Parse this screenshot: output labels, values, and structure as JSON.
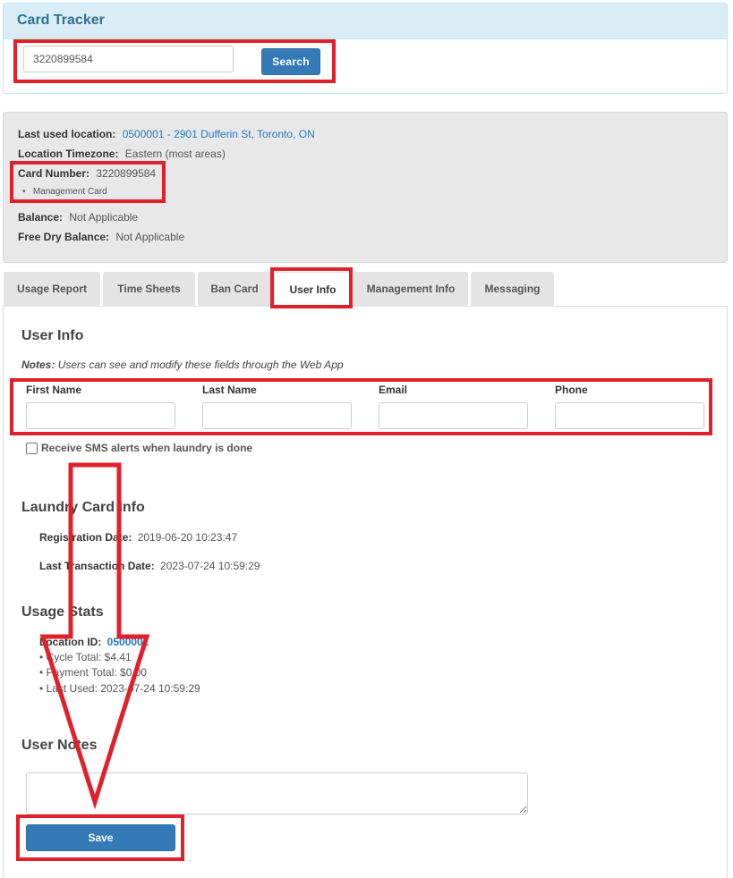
{
  "header": {
    "title": "Card Tracker"
  },
  "search": {
    "value": "3220899584",
    "button_label": "Search"
  },
  "card_info": {
    "last_used_location_label": "Last used location:",
    "last_used_location_value": "0500001 - 2901 Dufferin St, Toronto, ON",
    "timezone_label": "Location Timezone:",
    "timezone_value": "Eastern (most areas)",
    "card_number_label": "Card Number:",
    "card_number_value": "3220899584",
    "card_type": "Management Card",
    "balance_label": "Balance:",
    "balance_value": "Not Applicable",
    "free_dry_label": "Free Dry Balance:",
    "free_dry_value": "Not Applicable"
  },
  "tabs": [
    {
      "label": "Usage Report"
    },
    {
      "label": "Time Sheets"
    },
    {
      "label": "Ban Card"
    },
    {
      "label": "User Info"
    },
    {
      "label": "Management Info"
    },
    {
      "label": "Messaging"
    }
  ],
  "active_tab": "User Info",
  "user_info": {
    "heading": "User Info",
    "notes_label": "Notes:",
    "notes_text": "Users can see and modify these fields through the Web App",
    "fields": [
      {
        "label": "First Name",
        "value": ""
      },
      {
        "label": "Last Name",
        "value": ""
      },
      {
        "label": "Email",
        "value": ""
      },
      {
        "label": "Phone",
        "value": ""
      }
    ],
    "sms_label": "Receive SMS alerts when laundry is done",
    "sms_checked": false
  },
  "laundry_card": {
    "heading": "Laundry Card Info",
    "registration_label": "Registration Date:",
    "registration_value": "2019-06-20 10:23:47",
    "last_transaction_label": "Last Transaction Date:",
    "last_transaction_value": "2023-07-24 10:59:29"
  },
  "usage_stats": {
    "heading": "Usage Stats",
    "location_label": "Location ID:",
    "location_value": "0500001",
    "lines": [
      "• Cycle Total: $4.41",
      "• Payment Total: $0.00",
      "• Last Used: 2023-07-24 10:59:29"
    ]
  },
  "user_notes": {
    "heading": "User Notes",
    "value": "",
    "save_label": "Save"
  },
  "colors": {
    "accent": "#337ab7",
    "annotation": "#e0202a",
    "header_bg": "#d9edf7",
    "well_bg": "#e8e8e8"
  }
}
